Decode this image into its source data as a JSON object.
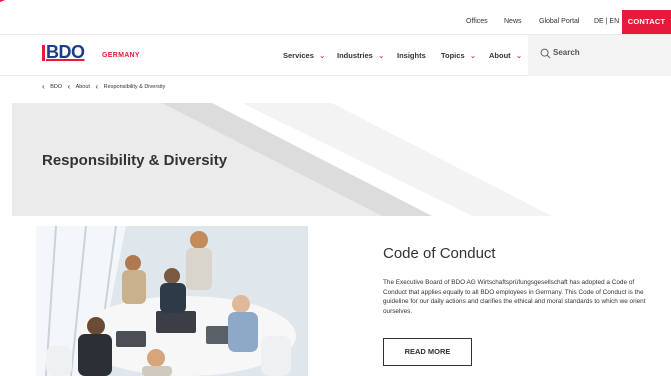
{
  "topbar": {
    "offices": "Offices",
    "news": "News",
    "global_portal": "Global Portal",
    "lang": "DE | EN",
    "contact": "CONTACT"
  },
  "brand": {
    "logo_text": "BDO",
    "country": "GERMANY",
    "accent_color": "#e81a3b",
    "logo_color": "#1f3c88"
  },
  "nav": {
    "items": [
      {
        "label": "Services",
        "has_menu": true
      },
      {
        "label": "Industries",
        "has_menu": true
      },
      {
        "label": "Insights",
        "has_menu": false
      },
      {
        "label": "Topics",
        "has_menu": true
      },
      {
        "label": "About",
        "has_menu": true
      }
    ],
    "search_label": "Search"
  },
  "breadcrumb": [
    "BDO",
    "About",
    "Responsibility & Diversity"
  ],
  "hero": {
    "title": "Responsibility & Diversity"
  },
  "card": {
    "title": "Code of Conduct",
    "body": "The Executive Board of BDO AG Wirtschaftsprüfungsgesellschaft has adopted a Code of Conduct that applies equally to all BDO employees in Germany. This Code of Conduct is the guideline for our daily actions and clarifies the ethical and moral standards to which we orient ourselves.",
    "button": "READ MORE"
  }
}
